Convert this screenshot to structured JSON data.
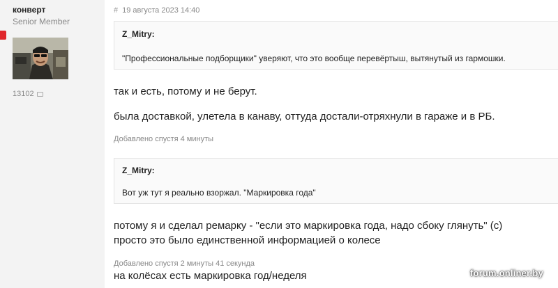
{
  "author": {
    "username": "конверт",
    "title": "Senior Member",
    "post_count": "13102",
    "post_count_icon": "message-icon",
    "online_indicator_color": "#e0262b"
  },
  "post": {
    "hash": "#",
    "date": "19 августа 2023 14:40",
    "quote1": {
      "author": "Z_Mitry:",
      "text": "\"Профессиональные подборщики\" уверяют, что это вообще перевёртыш, вытянутый из гармошки."
    },
    "reply1": {
      "line1": "так и есть, потому и не берут.",
      "line2": "была доставкой, улетела в канаву, оттуда достали-отряхнули в гараже и в РБ."
    },
    "added1": "Добавлено спустя 4 минуты",
    "quote2": {
      "author": "Z_Mitry:",
      "text": "Вот уж тут я реально взоржал. \"Маркировка года\""
    },
    "reply2": {
      "line1": "потому я и сделал ремарку - \"если это маркировка года, надо сбоку глянуть\" (c)",
      "line2": "просто это было единственной информацией о колесе"
    },
    "added2": "Добавлено спустя 2 минуты 41 секунда",
    "reply3": {
      "line1": "на колёсах есть маркировка год/неделя"
    }
  },
  "watermark": "forum.onliner.by"
}
